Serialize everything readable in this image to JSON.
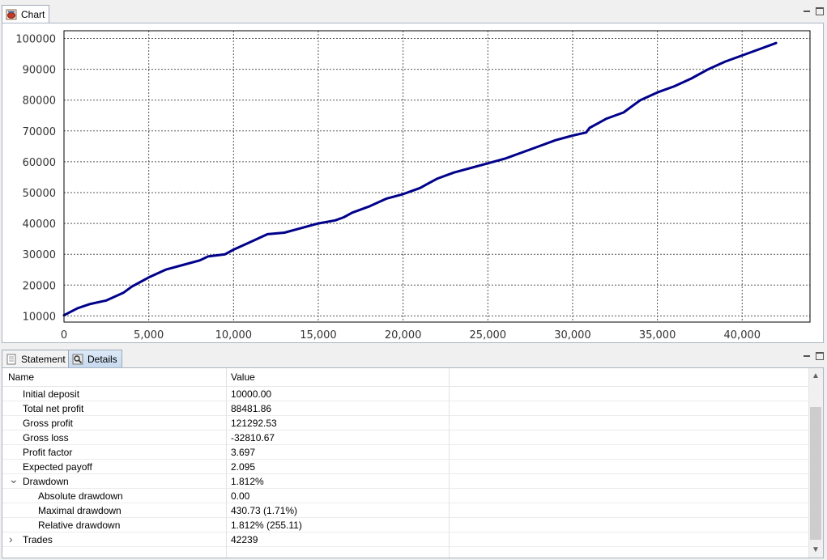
{
  "chart_panel": {
    "tab_label": "Chart",
    "tab_icon": "chart-icon"
  },
  "details_panel": {
    "tabs": [
      {
        "label": "Statement",
        "icon": "statement-icon"
      },
      {
        "label": "Details",
        "icon": "details-icon"
      }
    ],
    "columns": [
      "Name",
      "Value"
    ],
    "rows": [
      {
        "name": "Initial deposit",
        "value": "10000.00",
        "indent": 1
      },
      {
        "name": "Total net profit",
        "value": "88481.86",
        "indent": 1
      },
      {
        "name": "Gross profit",
        "value": "121292.53",
        "indent": 1
      },
      {
        "name": "Gross loss",
        "value": "-32810.67",
        "indent": 1
      },
      {
        "name": "Profit factor",
        "value": "3.697",
        "indent": 1
      },
      {
        "name": "Expected payoff",
        "value": "2.095",
        "indent": 1
      },
      {
        "name": "Drawdown",
        "value": "1.812%",
        "indent": 1,
        "twisty": "expanded"
      },
      {
        "name": "Absolute drawdown",
        "value": "0.00",
        "indent": 2
      },
      {
        "name": "Maximal drawdown",
        "value": "430.73 (1.71%)",
        "indent": 2
      },
      {
        "name": "Relative drawdown",
        "value": "1.812% (255.11)",
        "indent": 2
      },
      {
        "name": "Trades",
        "value": "42239",
        "indent": 1,
        "twisty": "collapsed"
      }
    ]
  },
  "chart_data": {
    "type": "line",
    "x_ticks": [
      "0",
      "5,000",
      "10,000",
      "15,000",
      "20,000",
      "25,000",
      "30,000",
      "35,000",
      "40,000"
    ],
    "y_ticks": [
      "10000",
      "20000",
      "30000",
      "40000",
      "50000",
      "60000",
      "70000",
      "80000",
      "90000",
      "100000"
    ],
    "xlim": [
      0,
      44000
    ],
    "ylim": [
      8000,
      102500
    ],
    "grid": true,
    "line_color": "#00008b",
    "series": [
      {
        "x": [
          0,
          800,
          1500,
          2500,
          3500,
          4000,
          4500,
          5000,
          6000,
          7000,
          8000,
          8500,
          9500,
          10000,
          11000,
          12000,
          13000,
          14000,
          15000,
          16000,
          16500,
          17000,
          18000,
          19000,
          20000,
          21000,
          21500,
          22000,
          23000,
          24000,
          25000,
          26000,
          27000,
          28000,
          29000,
          30000,
          30800,
          31000,
          31500,
          32000,
          33000,
          33500,
          34000,
          35000,
          36000,
          37000,
          38000,
          39000,
          40000,
          41000,
          42000
        ],
        "y": [
          10200,
          12500,
          13800,
          15000,
          17500,
          19500,
          21000,
          22500,
          25000,
          26500,
          28000,
          29300,
          30000,
          31500,
          34000,
          36500,
          37000,
          38500,
          40000,
          41000,
          42000,
          43500,
          45500,
          48000,
          49500,
          51500,
          53000,
          54500,
          56500,
          58000,
          59500,
          61000,
          63000,
          65000,
          67000,
          68500,
          69500,
          71000,
          72500,
          74000,
          76000,
          78000,
          80000,
          82500,
          84500,
          87000,
          90000,
          92500,
          94500,
          96500,
          98500
        ]
      }
    ]
  }
}
